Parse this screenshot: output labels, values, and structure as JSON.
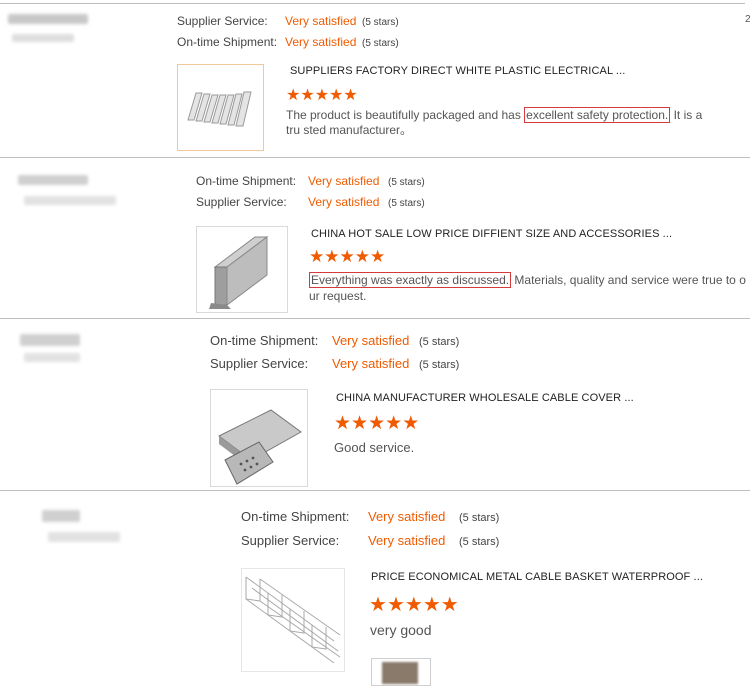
{
  "reviews": [
    {
      "ratings": [
        {
          "label": "Supplier Service:",
          "value": "Very satisfied",
          "stars": "(5 stars)"
        },
        {
          "label": "On-time Shipment:",
          "value": "Very satisfied",
          "stars": "(5 stars)"
        }
      ],
      "product_title": "SUPPLIERS FACTORY DIRECT WHITE PLASTIC ELECTRICAL ...",
      "star_rating": 5,
      "text_before": "The product is beautifully packaged and has ",
      "text_highlight": "excellent safety protection.",
      "text_after": " It is a tru sted manufacturer。"
    },
    {
      "ratings": [
        {
          "label": "On-time Shipment:",
          "value": "Very satisfied",
          "stars": "(5 stars)"
        },
        {
          "label": "Supplier Service:",
          "value": "Very satisfied",
          "stars": "(5 stars)"
        }
      ],
      "product_title": "CHINA HOT SALE LOW PRICE DIFFIENT SIZE AND ACCESSORIES ...",
      "star_rating": 5,
      "text_before": "",
      "text_highlight": "Everything was exactly as discussed.",
      "text_after": " Materials, quality and service were true to o ur request."
    },
    {
      "ratings": [
        {
          "label": "On-time Shipment:",
          "value": "Very satisfied",
          "stars": "(5 stars)"
        },
        {
          "label": "Supplier Service:",
          "value": "Very satisfied",
          "stars": "(5 stars)"
        }
      ],
      "product_title": "CHINA MANUFACTURER WHOLESALE CABLE COVER ...",
      "star_rating": 5,
      "text_before": "Good service.",
      "text_highlight": "",
      "text_after": ""
    },
    {
      "ratings": [
        {
          "label": "On-time Shipment:",
          "value": "Very satisfied",
          "stars": "(5 stars)"
        },
        {
          "label": "Supplier Service:",
          "value": "Very satisfied",
          "stars": "(5 stars)"
        }
      ],
      "product_title": "PRICE ECONOMICAL METAL CABLE BASKET WATERPROOF ...",
      "star_rating": 5,
      "text_before": "very good",
      "text_highlight": "",
      "text_after": ""
    }
  ],
  "edge_char": "2",
  "star_glyph": "★",
  "colors": {
    "accent": "#f05a00",
    "highlight_border": "#d63b3b",
    "divider": "#bdbdbd"
  }
}
